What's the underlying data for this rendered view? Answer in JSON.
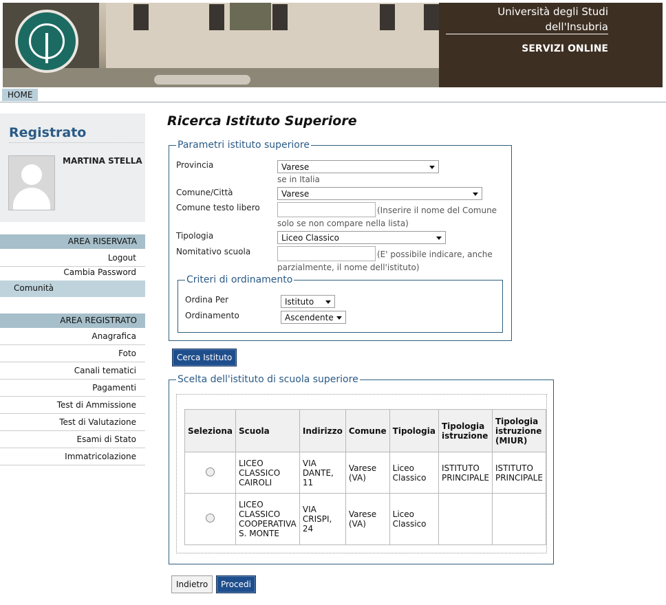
{
  "header": {
    "university_line1": "Università degli Studi",
    "university_line2": "dell'Insubria",
    "services": "SERVIZI ONLINE",
    "logo_icon": "university-seal-logo",
    "seal_text": "STUDIORUM INSUBRIAE · UNIVERSITAS ·"
  },
  "nav": {
    "home": "HOME"
  },
  "sidebar": {
    "title": "Registrato",
    "user_name": "MARTINA STELLA",
    "section1": "AREA RISERVATA",
    "section1_items": [
      "Logout",
      "Cambia Password"
    ],
    "active_item": "Comunità",
    "section2": "AREA REGISTRATO",
    "section2_items": [
      "Anagrafica",
      "Foto",
      "Canali tematici",
      "Pagamenti",
      "Test di Ammissione",
      "Test di Valutazione",
      "Esami di Stato",
      "Immatricolazione"
    ]
  },
  "page": {
    "title": "Ricerca Istituto Superiore",
    "params_legend": "Parametri istituto superiore",
    "provincia_label": "Provincia",
    "provincia_value": "Varese",
    "provincia_note": "se in Italia",
    "comune_label": "Comune/Città",
    "comune_value": "Varese",
    "comune_libero_label": "Comune testo libero",
    "comune_libero_value": "",
    "comune_libero_note1": "(Inserire il nome del Comune",
    "comune_libero_note2": "solo se non compare nella lista)",
    "tipologia_label": "Tipologia",
    "tipologia_value": "Liceo Classico",
    "nominativo_label": "Nomitativo scuola",
    "nominativo_value": "",
    "nominativo_note1": "(E' possibile indicare, anche",
    "nominativo_note2": "parzialmente, il nome dell'istituto)",
    "criteri_legend": "Criteri di ordinamento",
    "ordina_label": "Ordina Per",
    "ordina_value": "Istituto",
    "ordinamento_label": "Ordinamento",
    "ordinamento_value": "Ascendente",
    "search_button": "Cerca Istituto",
    "choice_legend": "Scelta dell'istituto di scuola superiore",
    "table": {
      "headers": [
        "Seleziona",
        "Scuola",
        "Indirizzo",
        "Comune",
        "Tipologia",
        "Tipologia istruzione",
        "Tipologia istruzione (MIUR)"
      ],
      "rows": [
        {
          "scuola": "LICEO CLASSICO CAIROLI",
          "indirizzo": "VIA DANTE, 11",
          "comune": "Varese (VA)",
          "tipologia": "Liceo Classico",
          "tip_istruzione": "ISTITUTO PRINCIPALE",
          "tip_miur": "ISTITUTO PRINCIPALE"
        },
        {
          "scuola": "LICEO CLASSICO COOPERATIVA S. MONTE",
          "indirizzo": "VIA CRISPI, 24",
          "comune": "Varese (VA)",
          "tipologia": "Liceo Classico",
          "tip_istruzione": "",
          "tip_miur": ""
        }
      ]
    },
    "back_button": "Indietro",
    "next_button": "Procedi"
  }
}
